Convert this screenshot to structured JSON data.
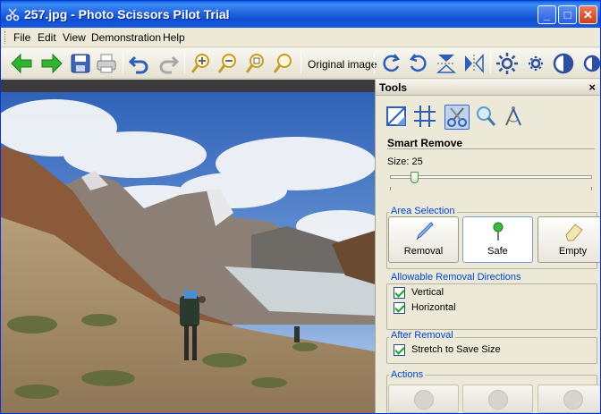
{
  "window": {
    "title": "257.jpg - Photo Scissors Pilot Trial"
  },
  "titlebar_buttons": [
    "_",
    "□",
    "✕"
  ],
  "menu": [
    "File",
    "Edit",
    "View",
    "Demonstration",
    "Help"
  ],
  "toolbar": {
    "original_image_label": "Original image"
  },
  "tools_panel": {
    "title": "Tools",
    "close": "×",
    "section_title": "Smart Remove",
    "size_label": "Size: 25",
    "size_value": 25,
    "area_selection": {
      "title": "Area Selection",
      "buttons": [
        "Removal",
        "Safe",
        "Empty"
      ],
      "selected": "Safe"
    },
    "directions": {
      "title": "Allowable Removal Directions",
      "options": [
        {
          "label": "Vertical",
          "checked": true
        },
        {
          "label": "Horizontal",
          "checked": true
        }
      ]
    },
    "after_removal": {
      "title": "After Removal",
      "options": [
        {
          "label": "Stretch to Save Size",
          "checked": true
        }
      ]
    },
    "actions": {
      "title": "Actions"
    }
  },
  "colors": {
    "accent": "#316ac5",
    "group_title": "#0046d5",
    "titlebar": "#2466e0"
  }
}
